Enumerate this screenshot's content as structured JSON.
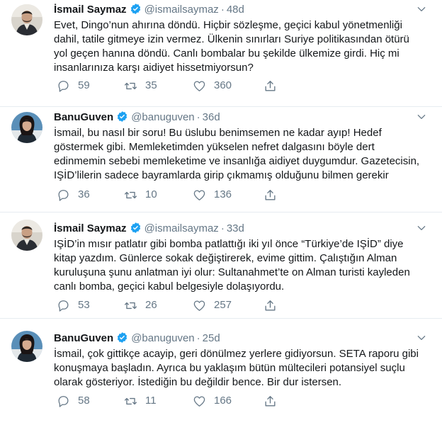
{
  "tweets": [
    {
      "name": "İsmail Saymaz",
      "handle": "@ismailsaymaz",
      "dot": "·",
      "time": "48d",
      "lines": [
        "Evet, Dingo’nun ahırına döndü. Hiçbir sözleşme, geçici kabul yönetmenliği",
        "dahil, tatile gitmeye izin vermez. Ülkenin sınırları Suriye politikasından ötürü",
        "yol geçen hanına döndü. Canlı bombalar bu şekilde ülkemize girdi. Hiç mi",
        "insanlarınıza karşı aidiyet hissetmiyorsun?"
      ],
      "replies": "59",
      "retweets": "35",
      "likes": "360"
    },
    {
      "name": "BanuGuven",
      "handle": "@banuguven",
      "dot": "·",
      "time": "36d",
      "lines": [
        "İsmail, bu nasıl bir soru! Bu üslubu benimsemen ne kadar ayıp! Hedef",
        "göstermek gibi. Memleketimden yükselen nefret dalgasını böyle dert",
        "edinmemin sebebi memleketime ve insanlığa aidiyet duygumdur. Gazetecisin,",
        "IŞİD’lilerin sadece bayramlarda girip çıkmamış olduğunu bilmen gerekir"
      ],
      "replies": "36",
      "retweets": "10",
      "likes": "136"
    },
    {
      "name": "İsmail Saymaz",
      "handle": "@ismailsaymaz",
      "dot": "·",
      "time": "33d",
      "lines": [
        "IŞİD’in mısır patlatır gibi bomba patlattığı iki yıl önce “Türkiye’de IŞİD” diye",
        "kitap yazdım. Günlerce sokak değiştirerek, evime gittim. Çalıştığın Alman",
        "kuruluşuna şunu anlatman iyi olur: Sultanahmet’te on Alman turisti kayleden",
        "canlı bomba, geçici kabul belgesiyle dolaşıyordu."
      ],
      "replies": "53",
      "retweets": "26",
      "likes": "257"
    },
    {
      "name": "BanuGuven",
      "handle": "@banuguven",
      "dot": "·",
      "time": "25d",
      "lines": [
        "İsmail, çok gittikçe acayip, geri dönülmez yerlere gidiyorsun. SETA raporu gibi",
        "konuşmaya başladın. Ayrıca bu yaklaşım bütün mültecileri potansiyel suçlu",
        "olarak gösteriyor. İstediğin bu değildir bence. Bir dur istersen."
      ],
      "replies": "58",
      "retweets": "11",
      "likes": "166"
    }
  ],
  "colors": {
    "text": "#14171a",
    "secondary": "#657786",
    "verified": "#1da1f2",
    "separator": "#e6ecf0"
  },
  "icons": {
    "reply": "reply-icon",
    "retweet": "retweet-icon",
    "like": "heart-icon",
    "share": "share-icon",
    "verified": "verified-badge-icon",
    "menu": "chevron-down-icon"
  }
}
